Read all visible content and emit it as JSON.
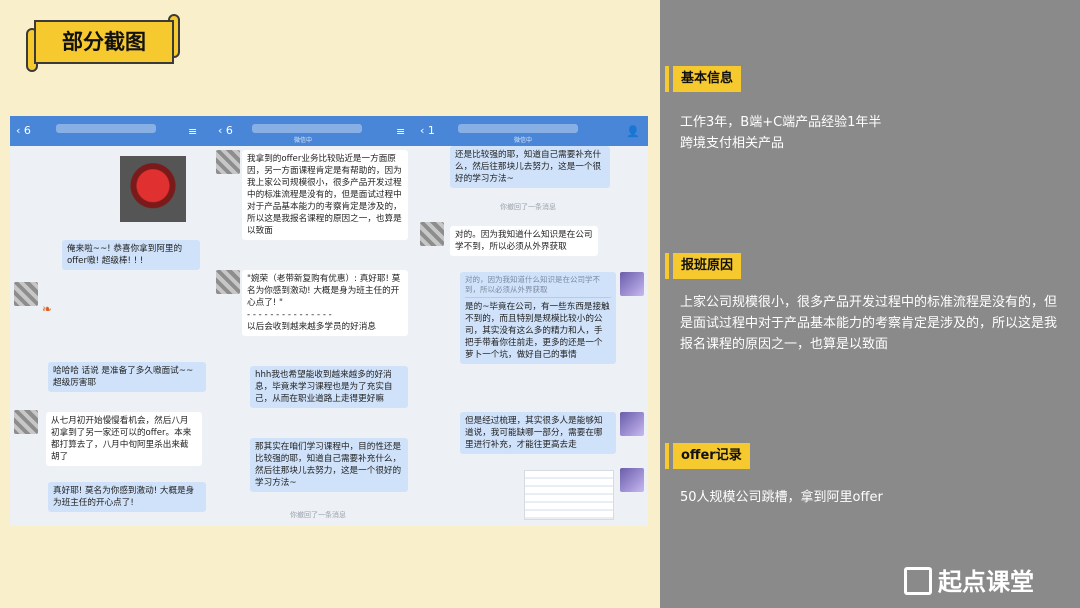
{
  "banner": {
    "title": "部分截图"
  },
  "chat": {
    "left": {
      "back_count": "6",
      "messages": [
        "俺来啦~~! 恭喜你拿到阿里的offer嗷! 超级棒! ! !",
        "哈哈哈 话说 是准备了多久嗷面试~~超级厉害耶",
        "从七月初开始慢慢看机会，然后八月初拿到了另一家还可以的offer。本来都打算去了，八月中旬阿里杀出来截胡了",
        "真好耶! 莫名为你感到激动! 大概是身为班主任的开心点了!"
      ]
    },
    "middle": {
      "back_count": "6",
      "subtitle": "微信中",
      "messages": [
        "我拿到的offer业务比较贴近是一方面原因，另一方面课程肯定是有帮助的，因为我上家公司规模很小，很多产品开发过程中的标准流程是没有的，但是面试过程中对于产品基本能力的考察肯定是涉及的，所以这是我报名课程的原因之一，也算是以致面",
        "\"婉荣（老带新复购有优惠）: 真好耶! 莫名为你感到激动! 大概是身为班主任的开心点了! \"",
        "- - - - - - - - - - - - - - -",
        "以后会收到越来越多学员的好消息",
        "hhh我也希望能收到越来越多的好消息，毕竟来学习课程也是为了充实自己，从而在职业道路上走得更好嘛",
        "那其实在咱们学习课程中，目的性还是比较强的耶，知道自己需要补充什么，然后往那块儿去努力，这是一个很好的学习方法~"
      ],
      "recalled": "你撤回了一条消息"
    },
    "right": {
      "back_count": "1",
      "subtitle": "微信中",
      "messages": [
        "还是比较强的耶，知道自己需要补充什么，然后往那块儿去努力，这是一个很好的学习方法~",
        "对的。因为我知道什么知识是在公司学不到，所以必须从外界获取",
        "对的，因为我知道什么知识是在公司学不到，所以必须从外界获取",
        "是的~毕竟在公司，有一些东西是接触不到的，而且特别是规模比较小的公司，其实没有这么多的精力和人，手把手带着你往前走，更多的还是一个萝卜一个坑，做好自己的事情",
        "但是经过梳理，其实很多人是能够知道说，我可能缺哪一部分，需要在哪里进行补充，才能往更高去走"
      ],
      "recalled": "你撤回了一条消息"
    }
  },
  "info": {
    "basic": {
      "label": "基本信息",
      "lines": [
        "工作3年，B端+C端产品经验1年半",
        "跨境支付相关产品"
      ]
    },
    "reason": {
      "label": "报班原因",
      "text": "上家公司规模很小，很多产品开发过程中的标准流程是没有的，但是面试过程中对于产品基本能力的考察肯定是涉及的，所以这是我报名课程的原因之一，也算是以致面"
    },
    "offer": {
      "label": "offer记录",
      "text": "50人规模公司跳槽，拿到阿里offer"
    }
  },
  "logo": {
    "text": "起点课堂"
  },
  "colors": {
    "accent": "#f6c92e",
    "right_bg": "#8a8a8a",
    "left_bg": "#f9efcb",
    "chat_header": "#4a86d8"
  }
}
